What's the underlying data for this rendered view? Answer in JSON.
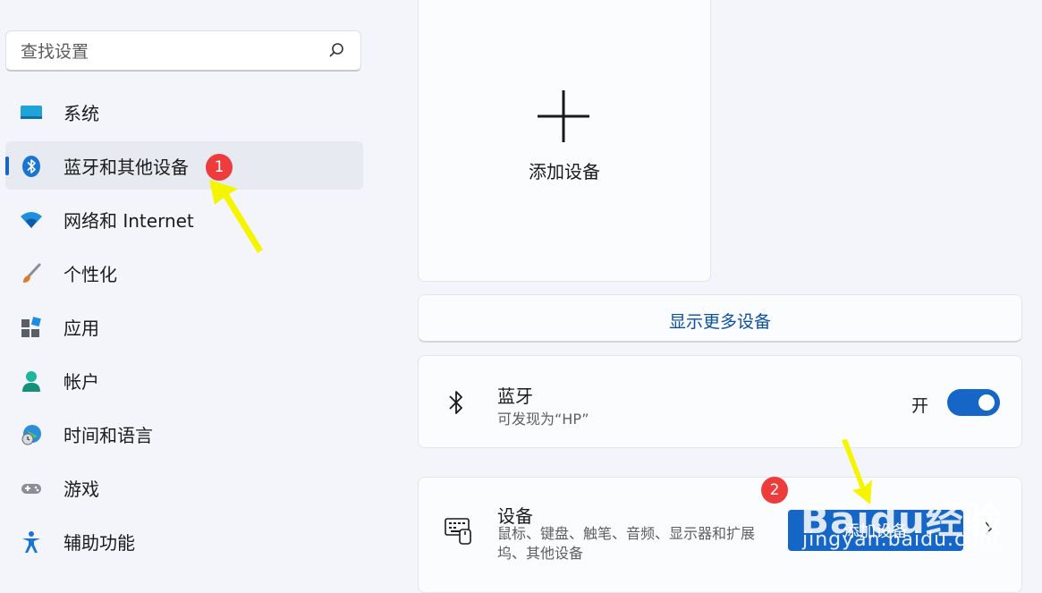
{
  "search": {
    "placeholder": "查找设置",
    "icon": "search-icon"
  },
  "sidebar": {
    "items": [
      {
        "label": "系统",
        "icon": "monitor-icon"
      },
      {
        "label": "蓝牙和其他设备",
        "icon": "bluetooth-icon",
        "active": true
      },
      {
        "label": "网络和 Internet",
        "icon": "wifi-icon"
      },
      {
        "label": "个性化",
        "icon": "paintbrush-icon"
      },
      {
        "label": "应用",
        "icon": "apps-icon"
      },
      {
        "label": "帐户",
        "icon": "account-icon"
      },
      {
        "label": "时间和语言",
        "icon": "globe-clock-icon"
      },
      {
        "label": "游戏",
        "icon": "gamepad-icon"
      },
      {
        "label": "辅助功能",
        "icon": "accessibility-icon"
      }
    ]
  },
  "annotations": {
    "badge1": "1",
    "badge2": "2"
  },
  "main": {
    "add_tile_label": "添加设备",
    "show_more": "显示更多设备",
    "bluetooth": {
      "title": "蓝牙",
      "subtitle": "可发现为“HP”",
      "state": "开",
      "enabled": true
    },
    "devices": {
      "title": "设备",
      "description": "鼠标、键盘、触笔、音频、显示器和扩展坞、其他设备",
      "button": "添加设备"
    }
  },
  "watermark": {
    "brand": "Baidu经验",
    "url": "jingyan.baidu.com"
  },
  "colors": {
    "accent": "#1666c7",
    "badge": "#ee3b3b",
    "arrow": "#f5f500"
  }
}
